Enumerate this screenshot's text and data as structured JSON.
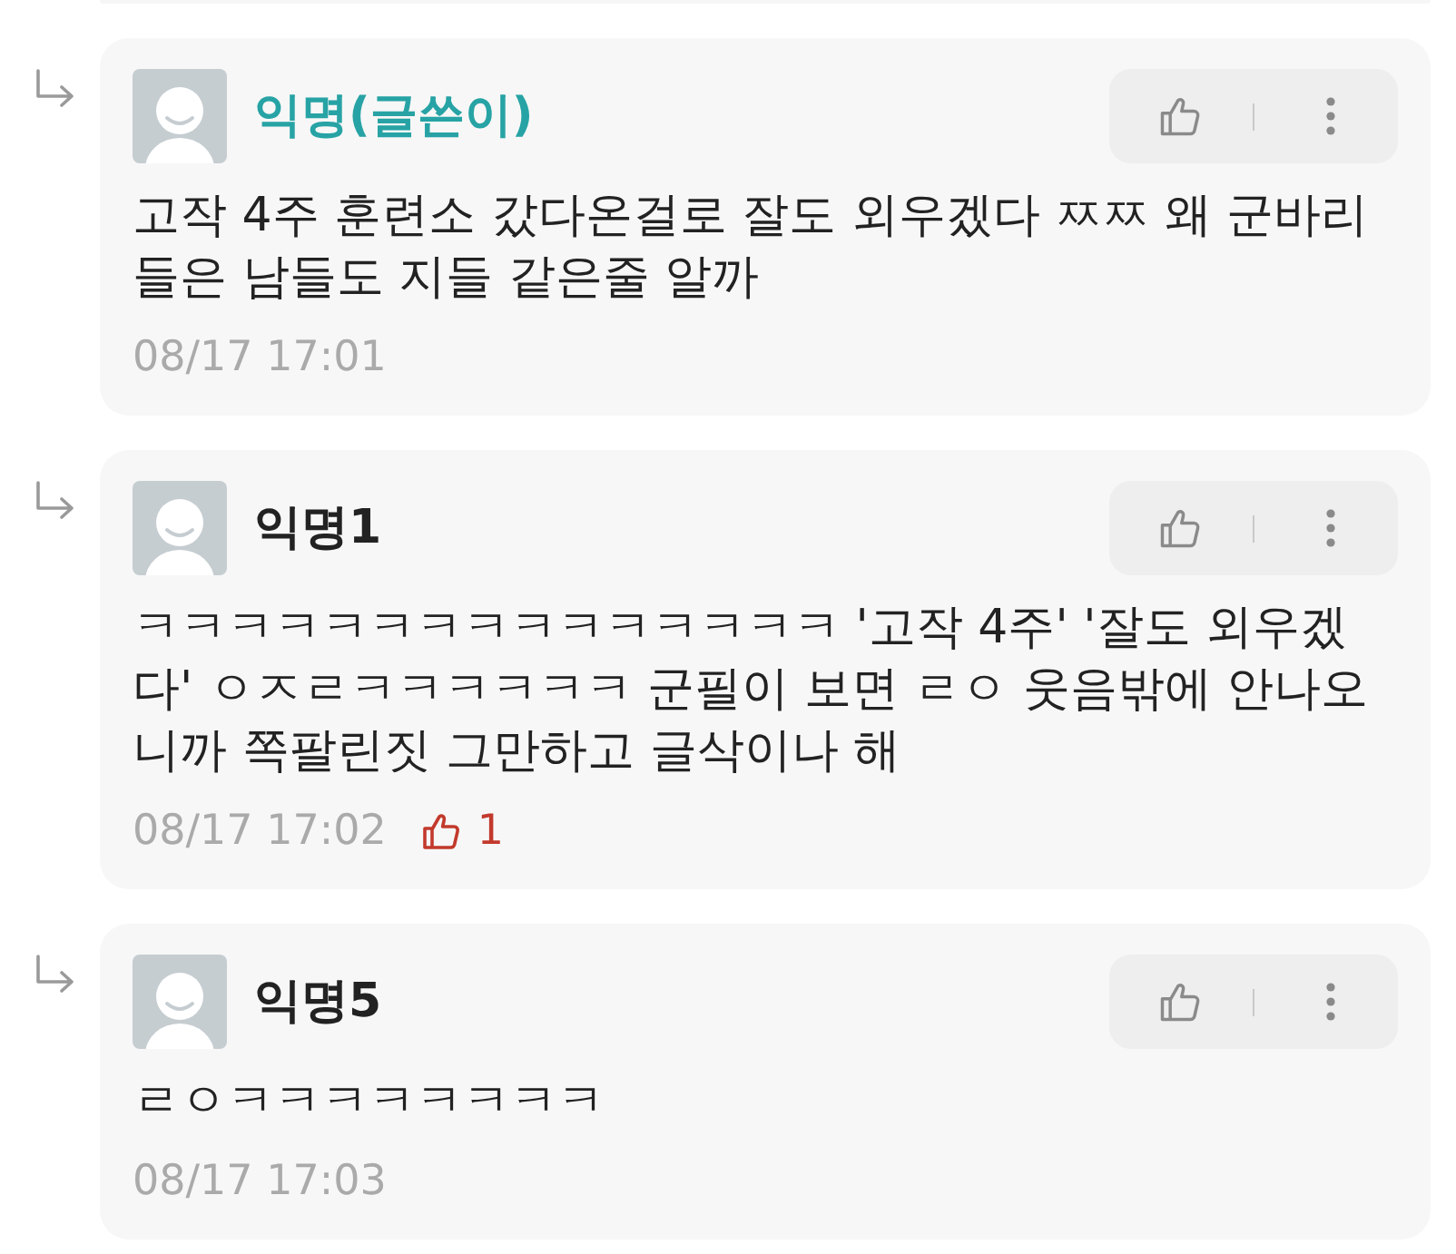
{
  "comments": [
    {
      "reply": true,
      "author": "익명(글쓴이)",
      "is_writer": true,
      "text": "고작 4주 훈련소 갔다온걸로 잘도 외우겠다 ㅉㅉ 왜 군바리들은 남들도 지들 같은줄 알까",
      "time": "08/17 17:01"
    },
    {
      "reply": true,
      "author": "익명1",
      "is_writer": false,
      "text": "ㅋㅋㅋㅋㅋㅋㅋㅋㅋㅋㅋㅋㅋㅋㅋ '고작 4주' '잘도 외우겠다' ㅇㅈㄹㅋㅋㅋㅋㅋㅋ 군필이 보면 ㄹㅇ 웃음밖에 안나오니까 쪽팔린짓 그만하고 글삭이나 해",
      "time": "08/17 17:02",
      "likes": "1"
    },
    {
      "reply": true,
      "author": "익명5",
      "is_writer": false,
      "text": "ㄹㅇㅋㅋㅋㅋㅋㅋㅋㅋ",
      "time": "08/17 17:03"
    }
  ]
}
